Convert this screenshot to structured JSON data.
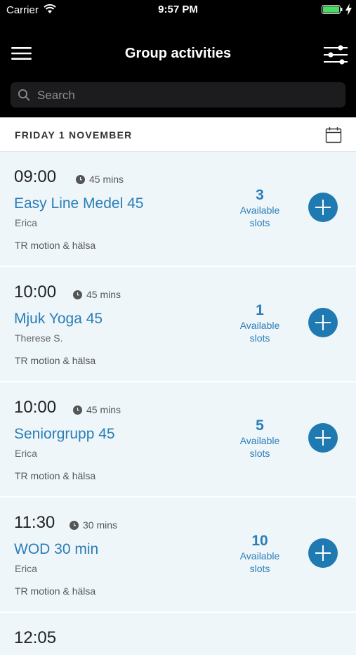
{
  "status_bar": {
    "carrier": "Carrier",
    "time": "9:57 PM"
  },
  "header": {
    "title": "Group activities"
  },
  "search": {
    "placeholder": "Search"
  },
  "date_bar": {
    "label": "FRIDAY 1 NOVEMBER"
  },
  "activities": [
    {
      "time": "09:00",
      "duration": "45 mins",
      "name": "Easy Line Medel 45",
      "instructor": "Erica",
      "venue": "TR motion & hälsa",
      "slots": "3",
      "slots_label_1": "Available",
      "slots_label_2": "slots"
    },
    {
      "time": "10:00",
      "duration": "45 mins",
      "name": "Mjuk Yoga 45",
      "instructor": "Therese S.",
      "venue": "TR motion & hälsa",
      "slots": "1",
      "slots_label_1": "Available",
      "slots_label_2": "slots"
    },
    {
      "time": "10:00",
      "duration": "45 mins",
      "name": "Seniorgrupp 45",
      "instructor": "Erica",
      "venue": "TR motion & hälsa",
      "slots": "5",
      "slots_label_1": "Available",
      "slots_label_2": "slots"
    },
    {
      "time": "11:30",
      "duration": "30 mins",
      "name": "WOD 30 min",
      "instructor": "Erica",
      "venue": "TR motion & hälsa",
      "slots": "10",
      "slots_label_1": "Available",
      "slots_label_2": "slots"
    }
  ],
  "peek": {
    "time": "12:05"
  },
  "colors": {
    "accent": "#2b7db6",
    "button": "#1f7ab1",
    "header_bg": "#000000",
    "list_bg": "#eef6fa",
    "battery": "#4cd964"
  },
  "icons": [
    "wifi-icon",
    "battery-icon",
    "charging-bolt-icon",
    "hamburger-menu-icon",
    "filter-sliders-icon",
    "search-icon",
    "calendar-icon",
    "clock-icon",
    "plus-icon"
  ]
}
